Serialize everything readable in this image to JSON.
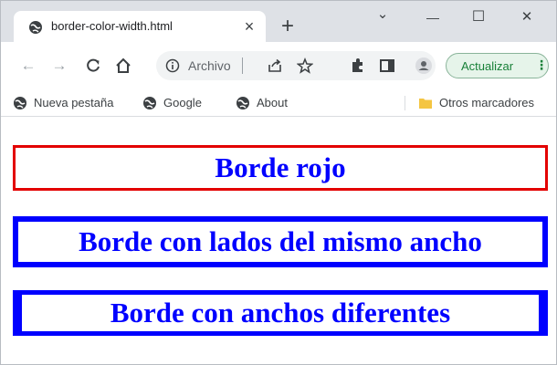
{
  "tab": {
    "title": "border-color-width.html",
    "close": "×",
    "new_tab": "+"
  },
  "window_controls": {
    "dropdown": "⌄",
    "minimize": "—",
    "maximize": "☐",
    "close": "✕"
  },
  "omnibox": {
    "text": "Archivo"
  },
  "update_button": {
    "label": "Actualizar",
    "menu": "⋮"
  },
  "bookmarks": {
    "items": [
      {
        "label": "Nueva pestaña",
        "icon": "globe-icon"
      },
      {
        "label": "Google",
        "icon": "globe-icon"
      },
      {
        "label": "About",
        "icon": "globe-icon"
      }
    ],
    "other": {
      "label": "Otros marcadores",
      "icon": "folder-icon"
    }
  },
  "page": {
    "boxes": [
      {
        "text": "Borde rojo",
        "border_color": "#e30000"
      },
      {
        "text": "Borde con lados del mismo ancho",
        "border_color": "#0000ff"
      },
      {
        "text": "Borde con anchos diferentes",
        "border_color": "#0000ff"
      }
    ],
    "text_color": "#0000ff"
  }
}
